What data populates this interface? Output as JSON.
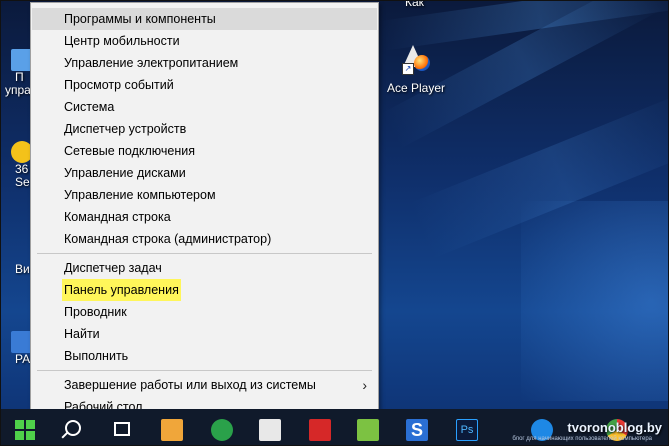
{
  "desktop": {
    "top_label": "Как",
    "icons": [
      {
        "label": "Ace Player",
        "icon": "ace-player-icon"
      }
    ],
    "left_icons": [
      {
        "label": "П",
        "label2": "упра"
      },
      {
        "label": "36",
        "label2": "Se"
      },
      {
        "label": "Ви",
        "label2": ""
      },
      {
        "label": "PA",
        "label2": ""
      }
    ]
  },
  "context_menu": {
    "group1": [
      "Программы и компоненты",
      "Центр мобильности",
      "Управление электропитанием",
      "Просмотр событий",
      "Система",
      "Диспетчер устройств",
      "Сетевые подключения",
      "Управление дисками",
      "Управление компьютером",
      "Командная строка",
      "Командная строка (администратор)"
    ],
    "group2": [
      "Диспетчер задач",
      "Панель управления",
      "Проводник",
      "Найти",
      "Выполнить"
    ],
    "group3": [
      "Завершение работы или выход из системы",
      "Рабочий стол"
    ],
    "hover_item": "Программы и компоненты",
    "highlighted_item": "Панель управления",
    "submenu_arrow": "›"
  },
  "taskbar": {
    "start_icon": "windows-start-icon",
    "search_icon": "search-icon",
    "task_view_icon": "task-view-icon",
    "apps": [
      {
        "name": "skype-icon",
        "glyph": "S"
      },
      {
        "name": "photoshop-icon",
        "glyph": "Ps"
      }
    ],
    "watermark": "tvoronoblog.by",
    "watermark_sub": "блог для начинающих пользователей компьютера"
  },
  "colors": {
    "menu_bg": "#f2f2f2",
    "hover_bg": "#dadada",
    "highlight": "#fff65a",
    "taskbar_bg": "#101a2b",
    "start_green": "#4fd14a"
  }
}
